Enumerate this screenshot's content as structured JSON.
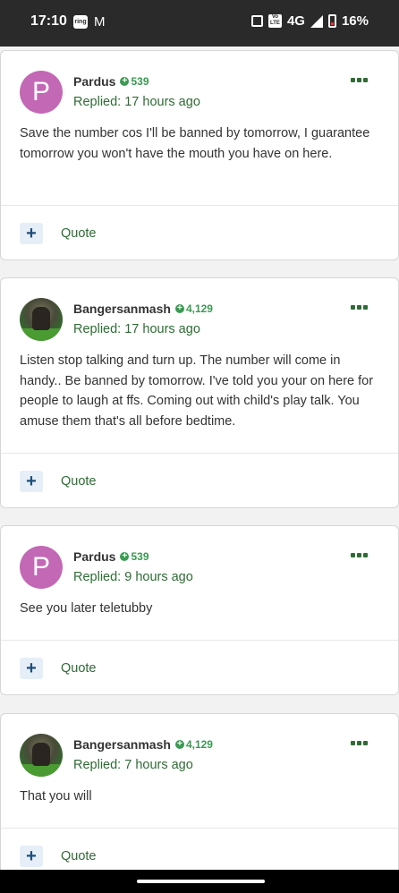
{
  "status": {
    "time": "17:10",
    "network": "4G",
    "battery": "16%",
    "ring_label": "ring"
  },
  "quote_label": "Quote",
  "posts": [
    {
      "avatar_letter": "P",
      "username": "Pardus",
      "reputation": "539",
      "replied": "Replied: 17 hours ago",
      "body": "Save the number cos I'll be banned by tomorrow, I guarantee tomorrow you won't have the mouth you have on here."
    },
    {
      "avatar_letter": "",
      "username": "Bangersanmash",
      "reputation": "4,129",
      "replied": "Replied: 17 hours ago",
      "body": "Listen stop talking and turn up. The number will come in handy.. Be banned by tomorrow. I've told you your on here for people to laugh at ffs. Coming out with child's play talk. You amuse them that's all before bedtime."
    },
    {
      "avatar_letter": "P",
      "username": "Pardus",
      "reputation": "539",
      "replied": "Replied: 9 hours ago",
      "body": "See you later teletubby"
    },
    {
      "avatar_letter": "",
      "username": "Bangersanmash",
      "reputation": "4,129",
      "replied": "Replied: 7 hours ago",
      "body": "That you will"
    }
  ],
  "colors": {
    "accent": "#2f6b35",
    "reputation": "#3a9a52",
    "avatar_p": "#c368b5"
  }
}
